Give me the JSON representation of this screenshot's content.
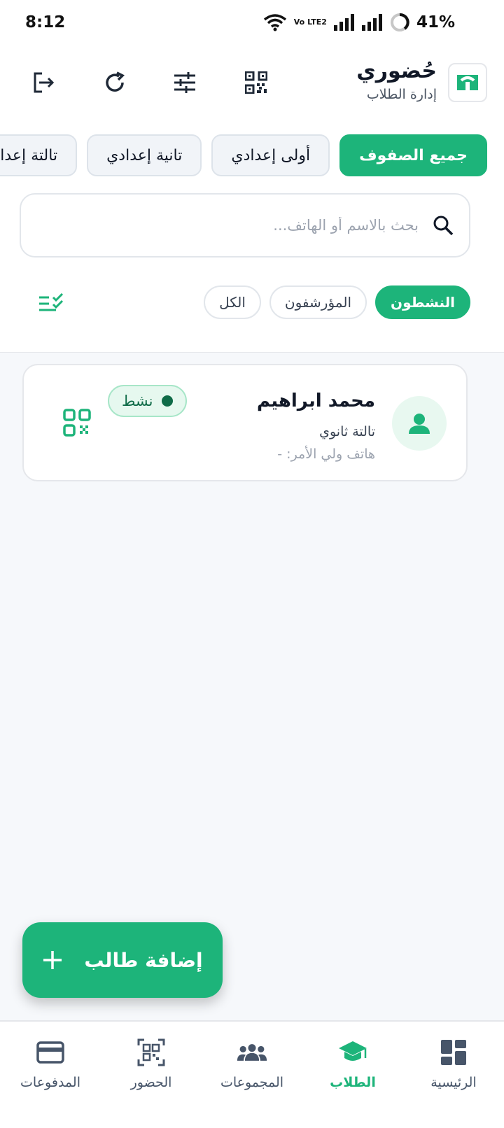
{
  "status_bar": {
    "time": "8:12",
    "volte": "Vo LTE2",
    "battery": "41%"
  },
  "header": {
    "title": "حُضوري",
    "subtitle": "إدارة الطلاب"
  },
  "class_tabs": [
    "جميع الصفوف",
    "أولى إعدادي",
    "تانية إعدادي",
    "تالتة إعدادي"
  ],
  "search": {
    "placeholder": "بحث بالاسم أو الهاتف..."
  },
  "status_filters": [
    "النشطون",
    "المؤرشفون",
    "الكل"
  ],
  "student": {
    "name": "محمد ابراهيم",
    "class": "تالتة ثانوي",
    "phone": "هاتف ولي الأمر: -",
    "status": "نشط"
  },
  "fab": {
    "label": "إضافة طالب"
  },
  "nav": [
    "الرئيسية",
    "الطلاب",
    "المجموعات",
    "الحضور",
    "المدفوعات"
  ],
  "colors": {
    "accent": "#1db47a",
    "badge_text": "#0f6b48"
  }
}
